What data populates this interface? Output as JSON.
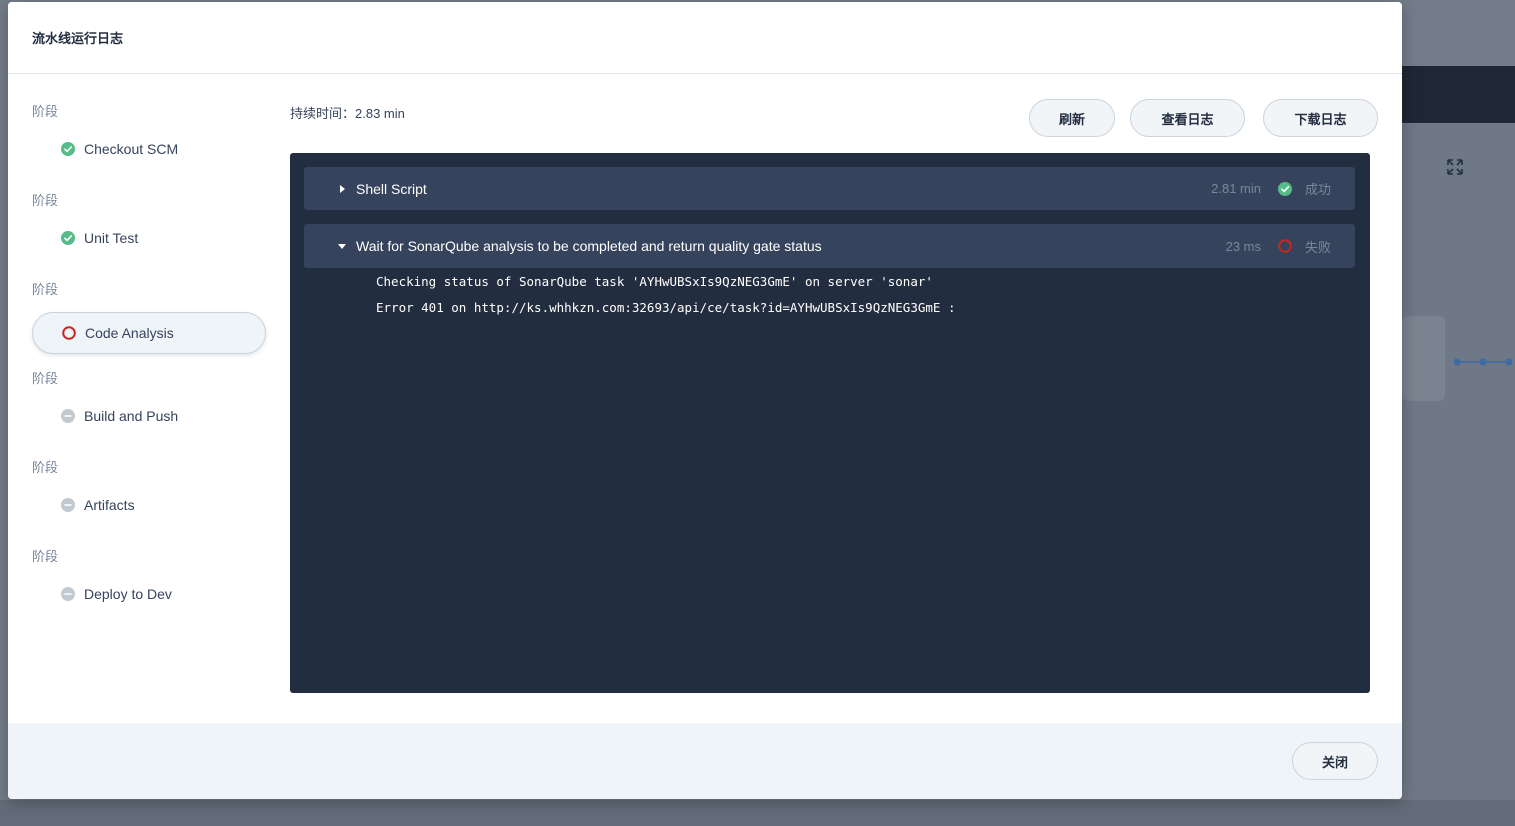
{
  "modal": {
    "title": "流水线运行日志"
  },
  "stages": [
    {
      "label": "阶段",
      "name": "Checkout SCM",
      "status": "success",
      "status_icon": "check-circle-icon"
    },
    {
      "label": "阶段",
      "name": "Unit Test",
      "status": "success",
      "status_icon": "check-circle-icon"
    },
    {
      "label": "阶段",
      "name": "Code Analysis",
      "status": "failed",
      "status_icon": "error-circle-icon",
      "active": true
    },
    {
      "label": "阶段",
      "name": "Build and Push",
      "status": "not-run",
      "status_icon": "minus-circle-icon"
    },
    {
      "label": "阶段",
      "name": "Artifacts",
      "status": "not-run",
      "status_icon": "minus-circle-icon"
    },
    {
      "label": "阶段",
      "name": "Deploy to Dev",
      "status": "not-run",
      "status_icon": "minus-circle-icon"
    }
  ],
  "main": {
    "duration": "持续时间：2.83 min",
    "buttons": {
      "refresh": "刷新",
      "view_log": "查看日志",
      "download_log": "下载日志"
    }
  },
  "steps": [
    {
      "title": "Shell Script",
      "time": "2.81 min",
      "status": "成功",
      "expanded": false
    },
    {
      "title": "Wait for SonarQube analysis to be completed and return quality gate status",
      "time": "23 ms",
      "status": "失败",
      "expanded": true
    }
  ],
  "log_lines": [
    "Checking status of SonarQube task 'AYHwUBSxIs9QzNEG3GmE' on server 'sonar'",
    "Error 401 on http://ks.whhkzn.com:32693/api/ce/task?id=AYHwUBSxIs9QzNEG3GmE :"
  ],
  "footer": {
    "close": "关闭"
  },
  "colors": {
    "success": "#55bc8a",
    "failed": "#ca2621",
    "not_run": "#c1c9d1",
    "log_background": "#232d40",
    "step_background": "#36435c"
  }
}
